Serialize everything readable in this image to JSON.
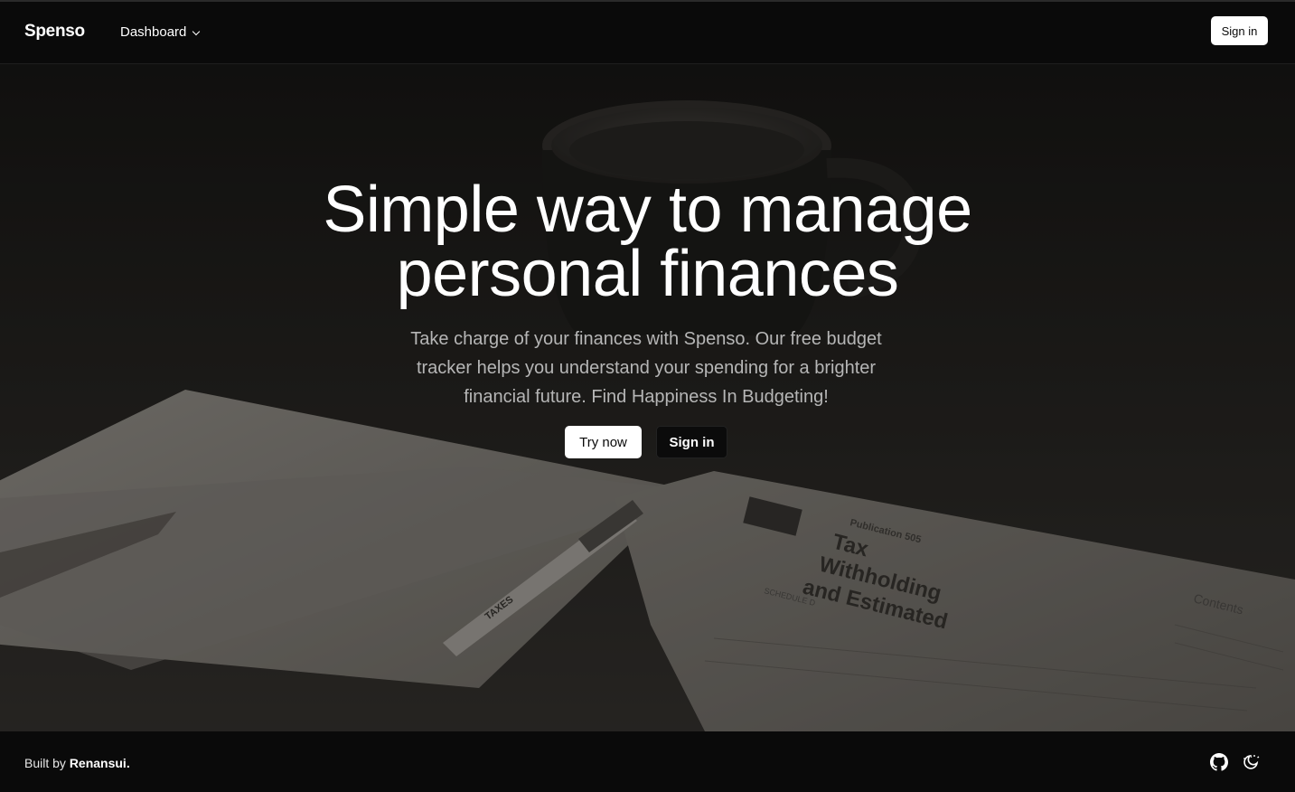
{
  "header": {
    "logo": "Spenso",
    "nav_dashboard": "Dashboard",
    "signin_label": "Sign in"
  },
  "hero": {
    "title_line1": "Simple way to manage",
    "title_line2": "personal finances",
    "subtitle": "Take charge of your finances with Spenso. Our free budget tracker helps you understand your spending for a brighter financial future. Find Happiness In Budgeting!",
    "try_now_label": "Try now",
    "signin_label": "Sign in",
    "background_text": {
      "publication": "Publication 505",
      "heading1": "Tax",
      "heading2": "Withholding",
      "heading3": "and Estimated",
      "contents": "Contents",
      "schedule": "SCHEDULE D",
      "pen": "TAXES"
    }
  },
  "footer": {
    "built_prefix": "Built by",
    "author": "Renansui",
    "built_suffix": ".",
    "github_icon": "github-icon",
    "theme_icon": "theme-toggle-icon"
  },
  "colors": {
    "background": "#0a0a0a",
    "text": "#ffffff",
    "subtext": "#b6b6b6",
    "button_light": "#ffffff"
  }
}
